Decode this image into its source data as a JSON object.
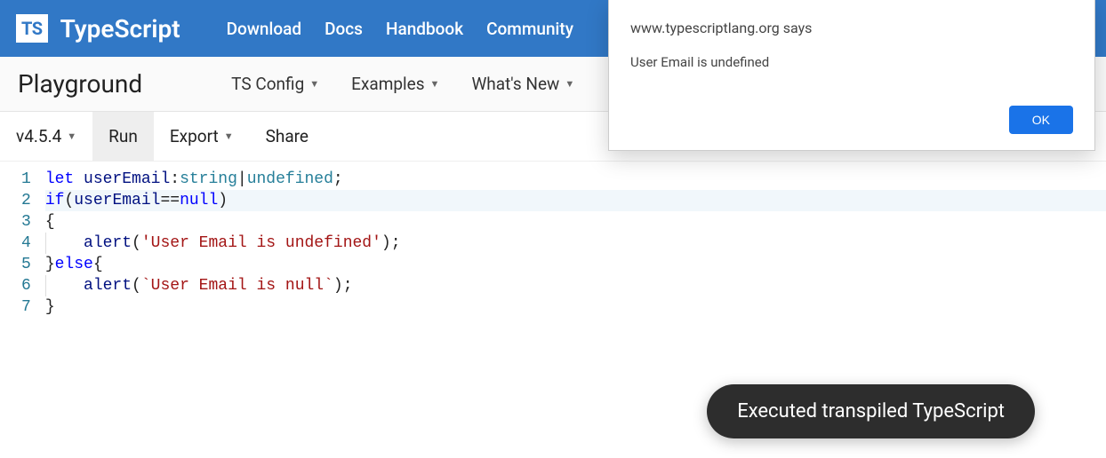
{
  "header": {
    "logo_abbr": "TS",
    "logo_text": "TypeScript",
    "nav": {
      "download": "Download",
      "docs": "Docs",
      "handbook": "Handbook",
      "community": "Community"
    }
  },
  "subnav": {
    "title": "Playground",
    "tsconfig": "TS Config",
    "examples": "Examples",
    "whatsnew": "What's New"
  },
  "toolbar": {
    "version": "v4.5.4",
    "run": "Run",
    "export": "Export",
    "share": "Share"
  },
  "editor": {
    "lines": [
      "1",
      "2",
      "3",
      "4",
      "5",
      "6",
      "7"
    ],
    "code": {
      "l1": {
        "kw1": "let",
        "sp1": " ",
        "id1": "userEmail",
        "p1": ":",
        "t1": "string",
        "p2": "|",
        "t2": "undefined",
        "p3": ";"
      },
      "l2": {
        "kw1": "if",
        "p1": "(",
        "id1": "userEmail",
        "p2": "==",
        "kw2": "null",
        "p3": ")"
      },
      "l3": {
        "p1": "{"
      },
      "l4": {
        "indent": "    ",
        "id1": "alert",
        "p1": "(",
        "s1": "'User Email is undefined'",
        "p2": ");"
      },
      "l5": {
        "p1": "}",
        "kw1": "else",
        "p2": "{"
      },
      "l6": {
        "indent": "    ",
        "id1": "alert",
        "p1": "(",
        "s1": "`User Email is null`",
        "p2": ");"
      },
      "l7": {
        "p1": "}"
      }
    }
  },
  "toast": {
    "text": "Executed transpiled TypeScript"
  },
  "dialog": {
    "title": "www.typescriptlang.org says",
    "message": "User Email is undefined",
    "ok": "OK"
  }
}
